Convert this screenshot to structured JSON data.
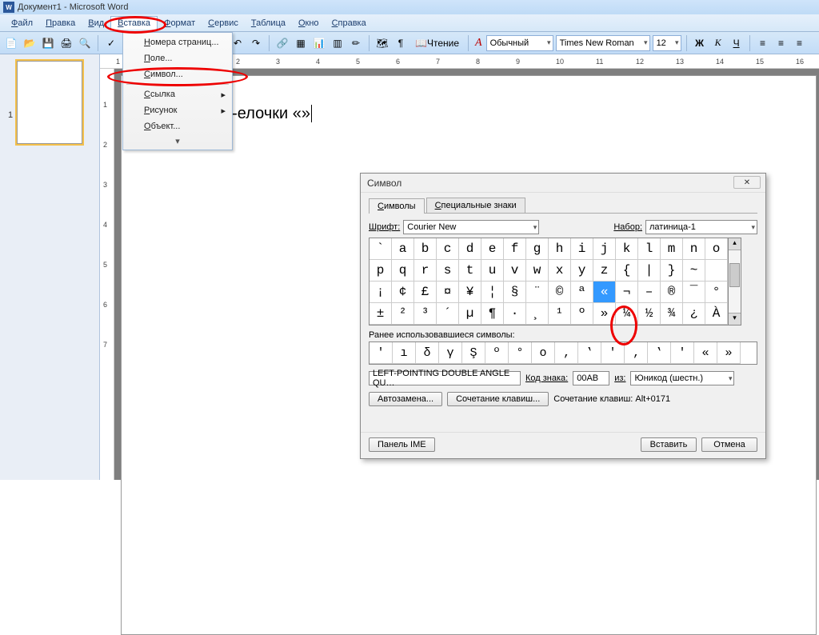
{
  "title": "Документ1 - Microsoft Word",
  "menubar": [
    "Файл",
    "Правка",
    "Вид",
    "Вставка",
    "Формат",
    "Сервис",
    "Таблица",
    "Окно",
    "Справка"
  ],
  "active_menu_index": 3,
  "dropdown": {
    "items": [
      {
        "label": "Номера страниц...",
        "arrow": false
      },
      {
        "label": "Поле...",
        "arrow": false
      },
      {
        "label": "Символ...",
        "arrow": false,
        "hl": true
      },
      {
        "label": "Ссылка",
        "arrow": true
      },
      {
        "label": "Рисунок",
        "arrow": true
      },
      {
        "label": "Объект...",
        "arrow": false
      }
    ]
  },
  "toolbar": {
    "reading_btn": "Чтение",
    "style_label": "Обычный",
    "font_label": "Times New Roman",
    "size_label": "12",
    "bold": "Ж",
    "italic": "К",
    "underline": "Ч"
  },
  "ruler_h": [
    1,
    0,
    1,
    2,
    3,
    4,
    5,
    6,
    7,
    8,
    9,
    10,
    11,
    12,
    13,
    14,
    15,
    16
  ],
  "ruler_v": [
    1,
    2,
    3,
    4,
    5,
    6,
    7
  ],
  "doc_text": "Кавычки-елочки «»",
  "thumb_page_num": "1",
  "dialog": {
    "title": "Символ",
    "tabs": [
      "Символы",
      "Специальные знаки"
    ],
    "active_tab": 0,
    "font_label": "Шрифт:",
    "font_value": "Courier New",
    "set_label": "Набор:",
    "set_value": "латиница-1",
    "grid": [
      [
        "`",
        "a",
        "b",
        "c",
        "d",
        "e",
        "f",
        "g",
        "h",
        "i",
        "j",
        "k",
        "l",
        "m",
        "n",
        "o"
      ],
      [
        "p",
        "q",
        "r",
        "s",
        "t",
        "u",
        "v",
        "w",
        "x",
        "y",
        "z",
        "{",
        "|",
        "}",
        "~",
        ""
      ],
      [
        "¡",
        "¢",
        "£",
        "¤",
        "¥",
        "¦",
        "§",
        "¨",
        "©",
        "ª",
        "«",
        "¬",
        "–",
        "®",
        "¯",
        "°"
      ],
      [
        "±",
        "²",
        "³",
        "´",
        "µ",
        "¶",
        "·",
        "¸",
        "¹",
        "º",
        "»",
        "¼",
        "½",
        "¾",
        "¿",
        "À"
      ]
    ],
    "selected_row": 2,
    "selected_col": 10,
    "recent_label": "Ранее использовавшиеся символы:",
    "recent": [
      "'",
      "ı",
      "δ",
      "γ",
      "Ş",
      "º",
      "°",
      "о",
      "‚",
      "‛",
      "'",
      "‚",
      "‛",
      "'",
      "«",
      "»"
    ],
    "char_name": "LEFT-POINTING DOUBLE ANGLE QU…",
    "code_label": "Код знака:",
    "code_value": "00AB",
    "from_label": "из:",
    "from_value": "Юникод (шестн.)",
    "btn_autocorrect": "Автозамена...",
    "btn_shortcut": "Сочетание клавиш...",
    "shortcut_text": "Сочетание клавиш: Alt+0171",
    "btn_ime": "Панель IME",
    "btn_insert": "Вставить",
    "btn_cancel": "Отмена"
  }
}
